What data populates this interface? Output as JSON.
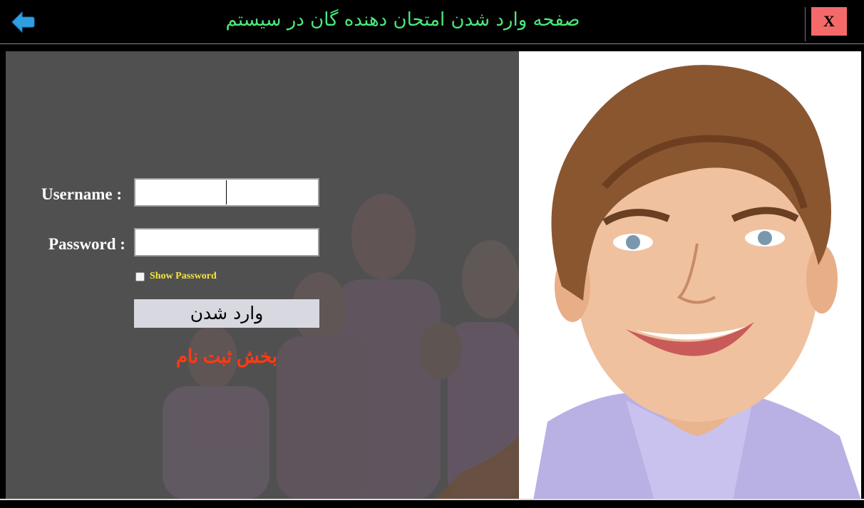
{
  "header": {
    "title": "صفحه وارد شدن امتحان دهنده گان در سیستم",
    "close_label": "X",
    "back_icon": "arrow-left-icon"
  },
  "form": {
    "username_label": "Username :",
    "username_value": "",
    "password_label": "Password :",
    "password_value": "",
    "show_password_label": "Show Password",
    "show_password_checked": false,
    "login_button_label": "وارد شدن",
    "register_link_label": "بخش ثبت نام"
  },
  "colors": {
    "title": "#4be87a",
    "close_button": "#f46a6a",
    "back_arrow": "#2f9fe0",
    "show_password_text": "#f4e542",
    "register_link": "#ff3a12",
    "login_button": "#d8d9e0",
    "panel": "#505050"
  }
}
